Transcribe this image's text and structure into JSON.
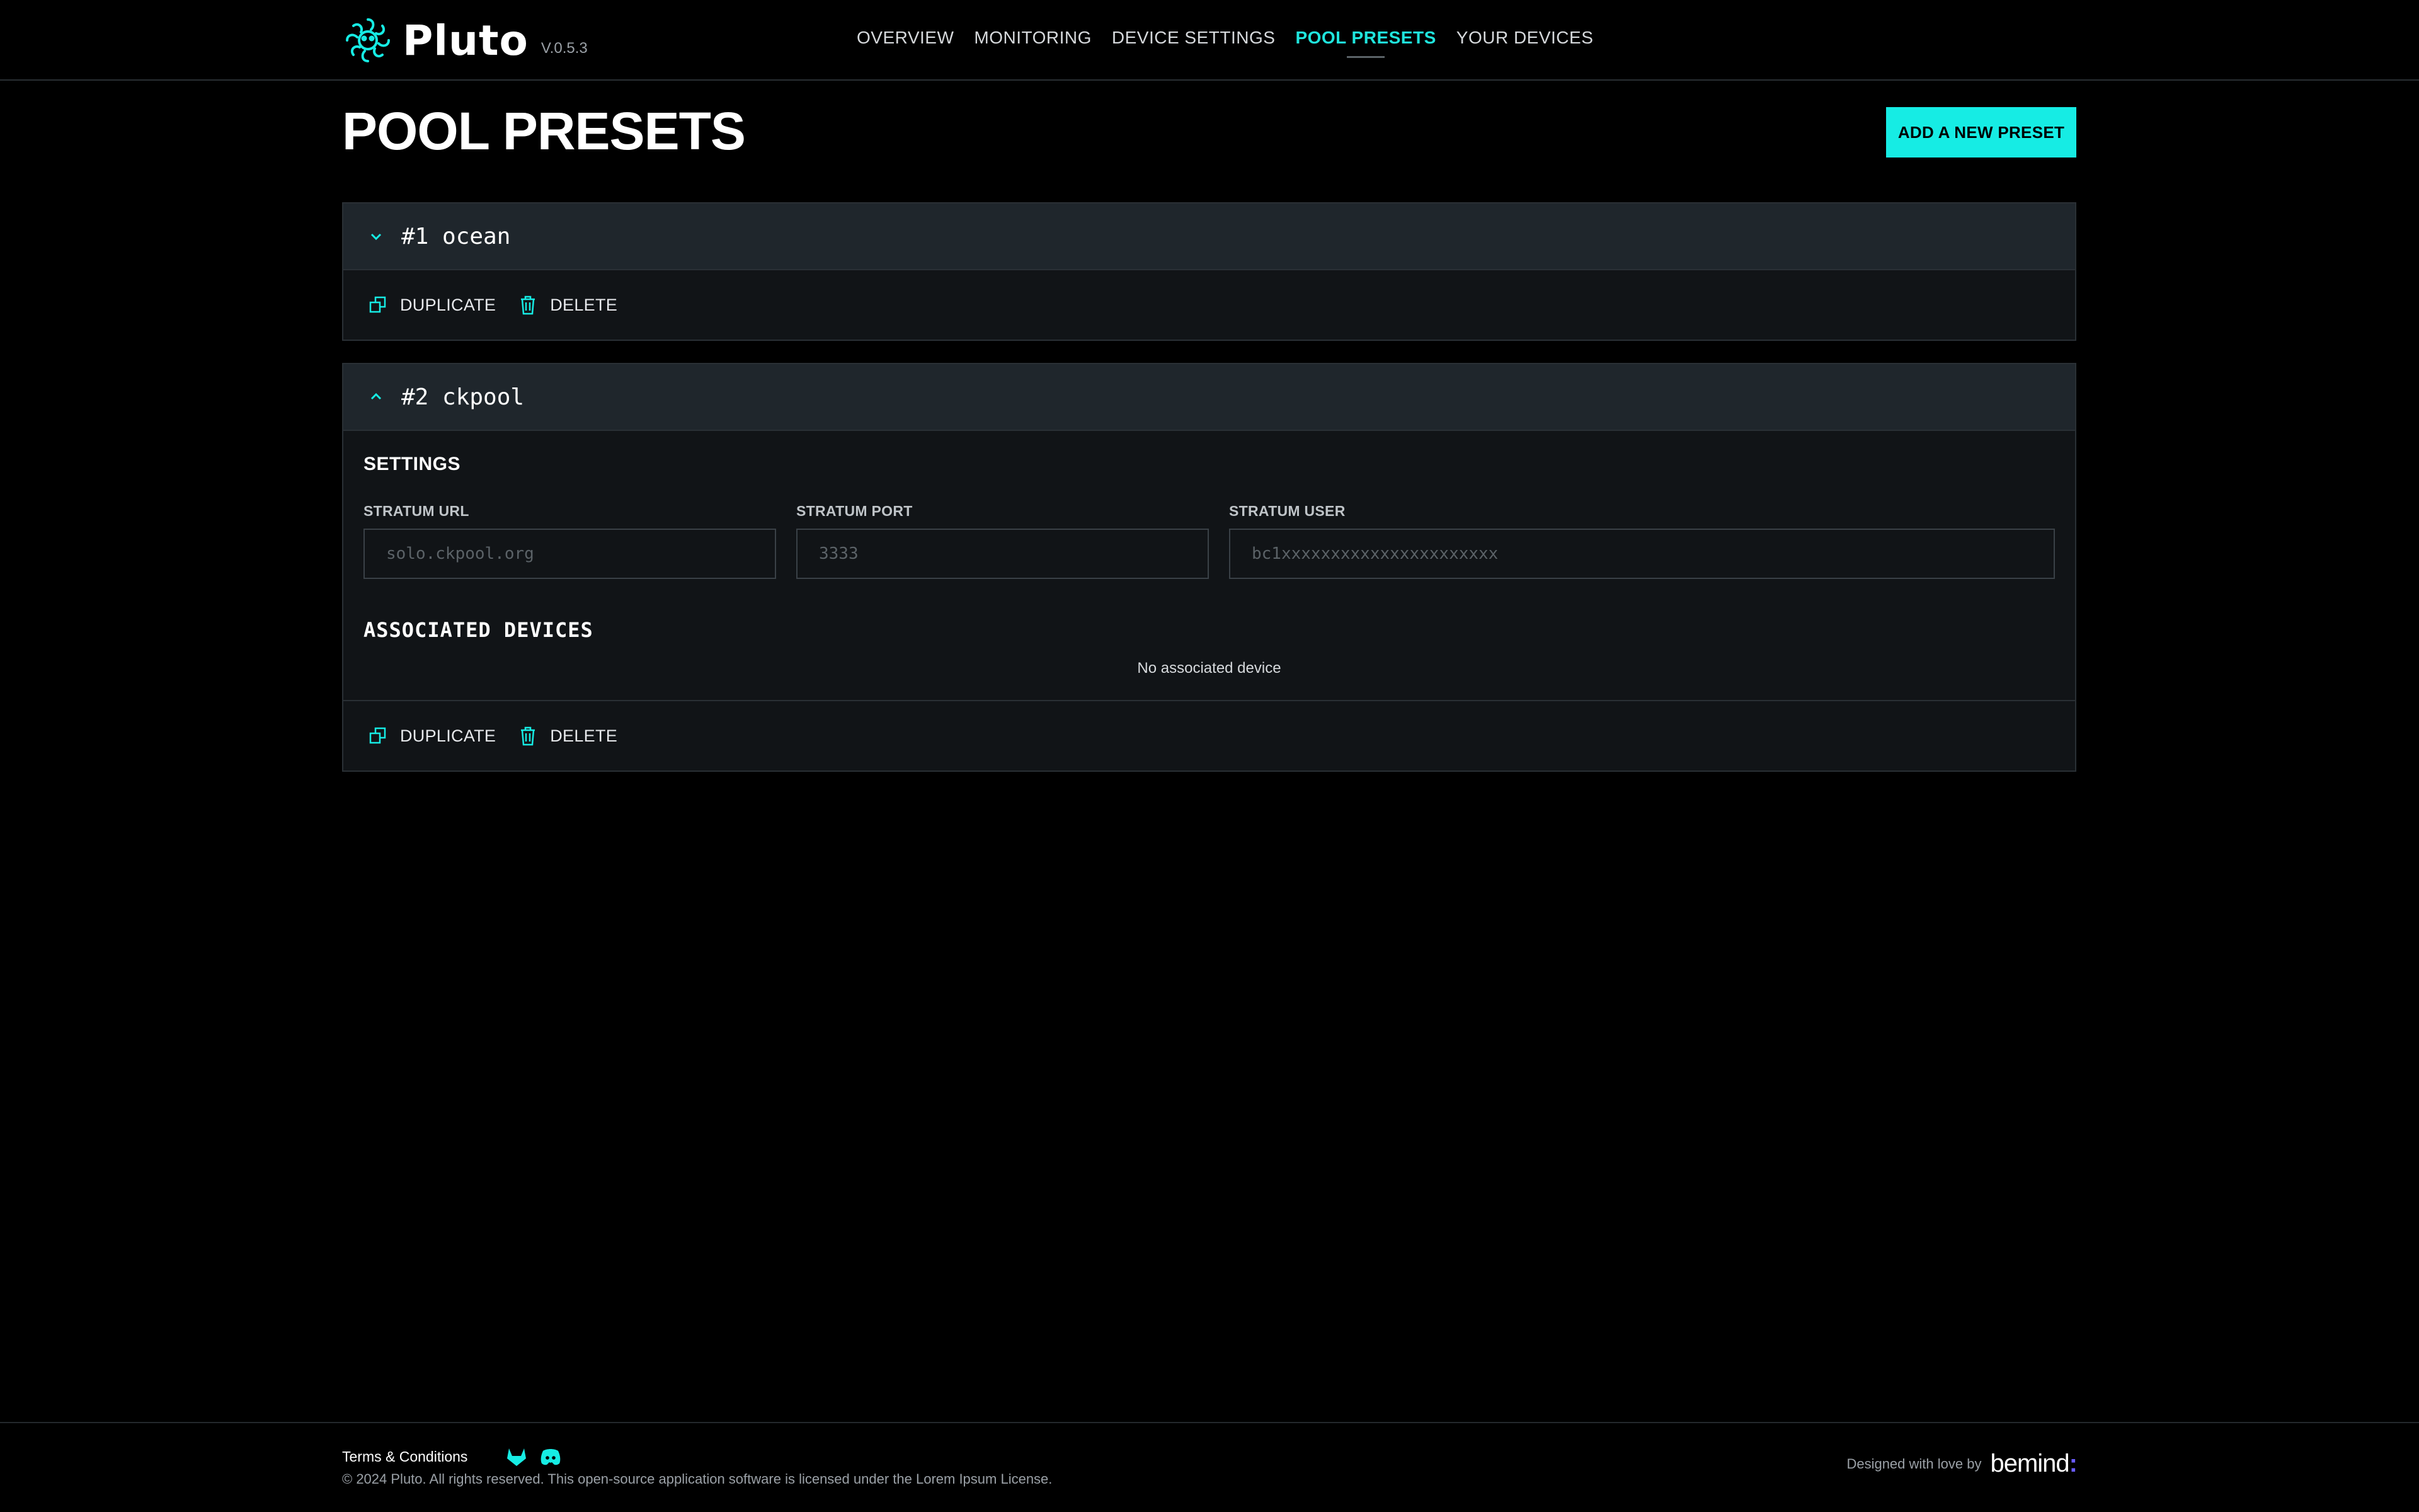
{
  "header": {
    "app_name": "Pluto",
    "version": "V.0.5.3",
    "nav": [
      {
        "label": "OVERVIEW",
        "active": false
      },
      {
        "label": "MONITORING",
        "active": false
      },
      {
        "label": "DEVICE SETTINGS",
        "active": false
      },
      {
        "label": "POOL PRESETS",
        "active": true
      },
      {
        "label": "YOUR DEVICES",
        "active": false
      }
    ]
  },
  "page": {
    "title": "POOL PRESETS",
    "add_button": "ADD A NEW PRESET"
  },
  "presets": [
    {
      "title": "#1 ocean",
      "expanded": false,
      "duplicate_label": "DUPLICATE",
      "delete_label": "DELETE"
    },
    {
      "title": "#2 ckpool",
      "expanded": true,
      "settings_title": "SETTINGS",
      "fields": {
        "url_label": "STRATUM URL",
        "url_placeholder": "solo.ckpool.org",
        "port_label": "STRATUM PORT",
        "port_placeholder": "3333",
        "user_label": "STRATUM USER",
        "user_placeholder": "bc1xxxxxxxxxxxxxxxxxxxxxx"
      },
      "associated_title": "ASSOCIATED DEVICES",
      "associated_empty": "No associated device",
      "duplicate_label": "DUPLICATE",
      "delete_label": "DELETE"
    }
  ],
  "footer": {
    "terms": "Terms & Conditions",
    "copyright": "© 2024 Pluto. All rights reserved. This open-source application software is licensed under the Lorem Ipsum License.",
    "credit": "Designed with love by",
    "brand": "bemind",
    "brand_mark": ":"
  },
  "colors": {
    "accent": "#16ece4",
    "background": "#000000",
    "card": "#111417",
    "card_header": "#1f262c"
  },
  "icons": [
    "pluto-logo-icon",
    "chevron-down-icon",
    "chevron-up-icon",
    "duplicate-icon",
    "trash-icon",
    "gitlab-icon",
    "discord-icon"
  ]
}
